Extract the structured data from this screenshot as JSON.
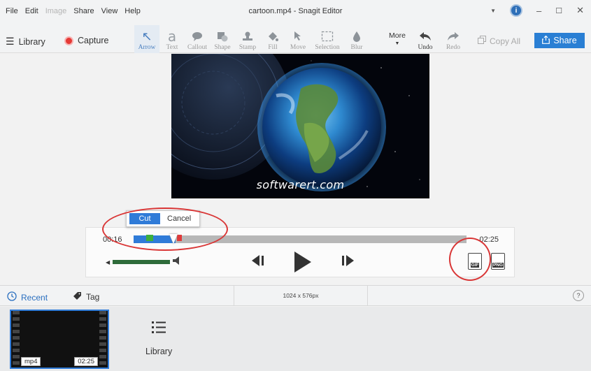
{
  "menu": {
    "items": [
      "File",
      "Edit",
      "Image",
      "Share",
      "View",
      "Help"
    ],
    "disabled": [
      "Image"
    ]
  },
  "window": {
    "title": "cartoon.mp4 - Snagit Editor",
    "minimize_glyph": "–",
    "maximize_glyph": "☐",
    "close_glyph": "✕"
  },
  "toolbar": {
    "library_label": "Library",
    "capture_label": "Capture",
    "tools": [
      {
        "label": "Arrow",
        "icon": "arrow-icon",
        "glyph": "↖",
        "active": true
      },
      {
        "label": "Text",
        "icon": "text-icon",
        "glyph": "a"
      },
      {
        "label": "Callout",
        "icon": "callout-icon",
        "glyph": "💬"
      },
      {
        "label": "Shape",
        "icon": "shape-icon",
        "glyph": "■"
      },
      {
        "label": "Stamp",
        "icon": "stamp-icon",
        "glyph": "⏏"
      },
      {
        "label": "Fill",
        "icon": "fill-icon",
        "glyph": "◆"
      },
      {
        "label": "Move",
        "icon": "move-icon",
        "glyph": "➤"
      },
      {
        "label": "Selection",
        "icon": "selection-icon",
        "glyph": "⬚"
      },
      {
        "label": "Blur",
        "icon": "blur-icon",
        "glyph": "💧"
      }
    ],
    "more_label": "More",
    "undo_label": "Undo",
    "redo_label": "Redo",
    "copy_all_label": "Copy All",
    "share_label": "Share"
  },
  "canvas": {
    "watermark": "softwarert.com"
  },
  "player": {
    "time_start": "00:16",
    "time_end": "02:25",
    "cut_label": "Cut",
    "cancel_label": "Cancel",
    "gif_label": "GIF",
    "png_label": "PNG"
  },
  "status": {
    "recent_label": "Recent",
    "tag_label": "Tag",
    "dimensions": "1024 x 576px",
    "help_label": "?"
  },
  "tray": {
    "item": {
      "format": "mp4",
      "duration": "02:25"
    },
    "library_label": "Library"
  },
  "colors": {
    "accent": "#2f7bd8",
    "annotation_red": "#d93636",
    "record_red": "#e53935"
  }
}
